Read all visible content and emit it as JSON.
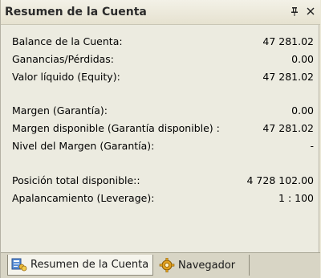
{
  "window": {
    "title": "Resumen de la Cuenta",
    "pin_glyph": "📌",
    "close_glyph": "✕"
  },
  "account_summary": {
    "rows": [
      {
        "label": "Balance de la Cuenta:",
        "value": "47 281.02"
      },
      {
        "label": "Ganancias/Pérdidas:",
        "value": "0.00"
      },
      {
        "label": "Valor líquido (Equity):",
        "value": "47 281.02"
      },
      {
        "label": "Margen (Garantía):",
        "value": "0.00"
      },
      {
        "label": "Margen disponible (Garantía disponible) :",
        "value": "47 281.02"
      },
      {
        "label": "Nivel del Margen (Garantía):",
        "value": "-"
      },
      {
        "label": "Posición total disponible::",
        "value": "4 728 102.00"
      },
      {
        "label": "Apalancamiento (Leverage):",
        "value": "1 : 100"
      }
    ]
  },
  "tabs": [
    {
      "label": "Resumen de la Cuenta",
      "icon": "account-summary-icon",
      "active": true
    },
    {
      "label": "Navegador",
      "icon": "navigator-gear-icon",
      "active": false
    }
  ],
  "colors": {
    "panel_bg": "#ecebe0",
    "titlebar_bg": "#e6e2d0",
    "tabbar_bg": "#d8d5c5",
    "active_tab_bg": "#f5f4ec"
  }
}
